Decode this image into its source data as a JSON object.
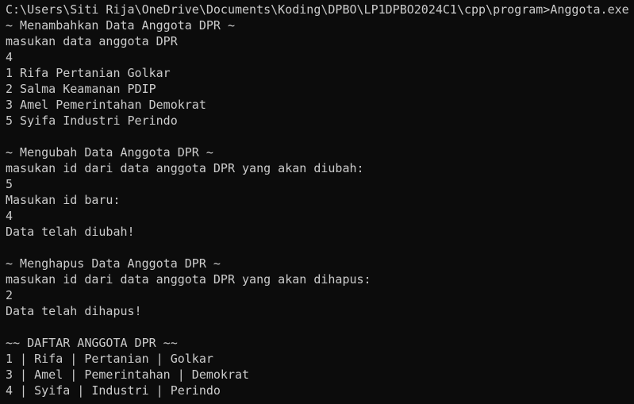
{
  "terminal": {
    "lines": [
      "C:\\Users\\Siti Rija\\OneDrive\\Documents\\Koding\\DPBO\\LP1DPBO2024C1\\cpp\\program>Anggota.exe",
      "~ Menambahkan Data Anggota DPR ~",
      "masukan data anggota DPR",
      "4",
      "1 Rifa Pertanian Golkar",
      "2 Salma Keamanan PDIP",
      "3 Amel Pemerintahan Demokrat",
      "5 Syifa Industri Perindo",
      "",
      "~ Mengubah Data Anggota DPR ~",
      "masukan id dari data anggota DPR yang akan diubah:",
      "5",
      "Masukan id baru:",
      "4",
      "Data telah diubah!",
      "",
      "~ Menghapus Data Anggota DPR ~",
      "masukan id dari data anggota DPR yang akan dihapus:",
      "2",
      "Data telah dihapus!",
      "",
      "~~ DAFTAR ANGGOTA DPR ~~",
      "1 | Rifa | Pertanian | Golkar",
      "3 | Amel | Pemerintahan | Demokrat",
      "4 | Syifa | Industri | Perindo"
    ]
  }
}
